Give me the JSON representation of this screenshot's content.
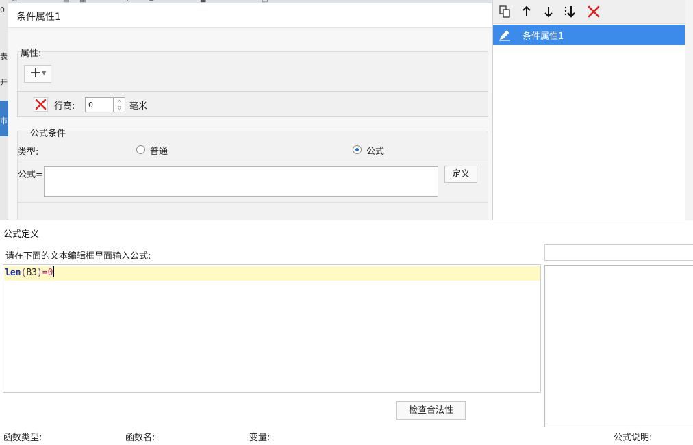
{
  "background": {
    "strip_fragments": [
      "0",
      "表",
      "开",
      "市"
    ],
    "toolbar_fragments": [
      "A",
      "▤",
      "▦",
      "‒",
      "⊥",
      "≡",
      "■",
      "□"
    ]
  },
  "condition_dialog": {
    "title": "条件属性1",
    "properties_label": "属性:",
    "add_symbol": "+",
    "row_height": {
      "label": "行高:",
      "value": "0",
      "unit": "毫米"
    },
    "formula_condition": {
      "label": "公式条件",
      "type_label": "类型:",
      "radio_normal": "普通",
      "radio_formula": "公式",
      "selected": "公式",
      "formula_label": "公式=",
      "formula_value": "",
      "define_button": "定义"
    }
  },
  "condition_list": {
    "toolbar_icons": [
      "copy-icon",
      "move-up-icon",
      "move-down-icon",
      "move-bottom-icon",
      "delete-icon"
    ],
    "items": [
      {
        "label": "条件属性1",
        "selected": true,
        "icon": "pencil-icon"
      }
    ]
  },
  "formula_dialog": {
    "title": "公式定义",
    "instruction": "请在下面的文本编辑框里面输入公式:",
    "formula_text": "len(B3)=0",
    "formula_tokens": {
      "func": "len",
      "open": "(",
      "arg": "B3",
      "close": ")",
      "op": "=",
      "value": "0"
    },
    "check_button": "检查合法性",
    "search_value": "",
    "columns": {
      "function_type": "函数类型:",
      "function_name": "函数名:",
      "variable": "变量:",
      "formula_description": "公式说明:"
    }
  },
  "colors": {
    "selection_blue": "#3c8bea",
    "delete_red": "#e02020",
    "current_line": "#fff9c4",
    "keyword_blue": "#1e2fb8",
    "number_pink": "#c22a7a"
  }
}
